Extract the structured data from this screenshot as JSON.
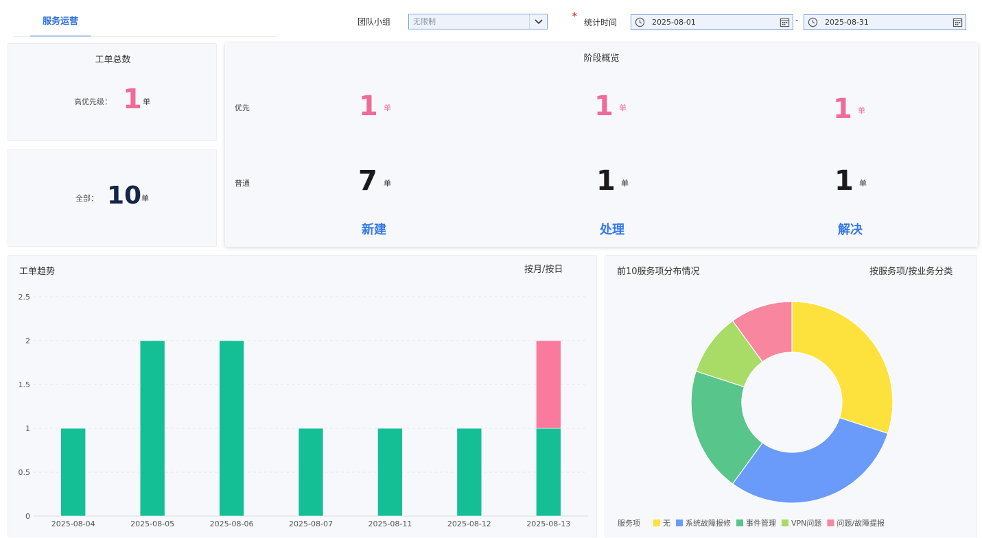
{
  "tabs": {
    "active": "服务运营"
  },
  "filters": {
    "team_label": "团队小组",
    "team_value": "无限制",
    "time_label": "统计时间",
    "required_mark": "*",
    "date_start": "2025-08-01",
    "date_sep": "-",
    "date_end": "2025-08-31"
  },
  "total_card": {
    "title": "工单总数",
    "high_label": "高优先级：",
    "high_value": "1",
    "unit": "单"
  },
  "all_card": {
    "label": "全部：",
    "value": "10",
    "unit": "单"
  },
  "stage": {
    "title": "阶段概览",
    "row_priority": "优先",
    "row_normal": "普通",
    "unit": "单",
    "columns": [
      {
        "label": "新建",
        "priority": "1",
        "normal": "7"
      },
      {
        "label": "处理",
        "priority": "1",
        "normal": "1"
      },
      {
        "label": "解决",
        "priority": "1",
        "normal": "1"
      }
    ]
  },
  "trend": {
    "title": "工单趋势",
    "switch": "按月/按日"
  },
  "dist": {
    "title": "前10服务项分布情况",
    "switch": "按服务项/按业务分类",
    "legend_title": "服务项"
  },
  "colors": {
    "accent": "#2f6fdb",
    "pink": "#f06b97",
    "teal": "#15bf96"
  },
  "chart_data": [
    {
      "type": "bar",
      "stacked": true,
      "categories": [
        "2025-08-04",
        "2025-08-05",
        "2025-08-06",
        "2025-08-07",
        "2025-08-11",
        "2025-08-12",
        "2025-08-13"
      ],
      "series": [
        {
          "values": [
            1,
            2,
            2,
            1,
            1,
            1,
            1
          ],
          "color": "#15bf96"
        },
        {
          "values": [
            0,
            0,
            0,
            0,
            0,
            0,
            1
          ],
          "color": "#f97a9d"
        }
      ],
      "ylim": [
        0,
        2.5
      ],
      "yticks": [
        "0",
        "0.5",
        "1",
        "1.5",
        "2",
        "2.5"
      ],
      "grid": true
    },
    {
      "type": "pie",
      "donut": true,
      "slices": [
        {
          "label": "无",
          "value": 3,
          "color": "#fde23e"
        },
        {
          "label": "系统故障报修",
          "value": 3,
          "color": "#6a9bfa"
        },
        {
          "label": "事件管理",
          "value": 2,
          "color": "#58c58a"
        },
        {
          "label": "VPN问题",
          "value": 1,
          "color": "#a8dc66"
        },
        {
          "label": "问题/故障提报",
          "value": 1,
          "color": "#f8869f"
        }
      ],
      "legend": "bottom"
    }
  ]
}
